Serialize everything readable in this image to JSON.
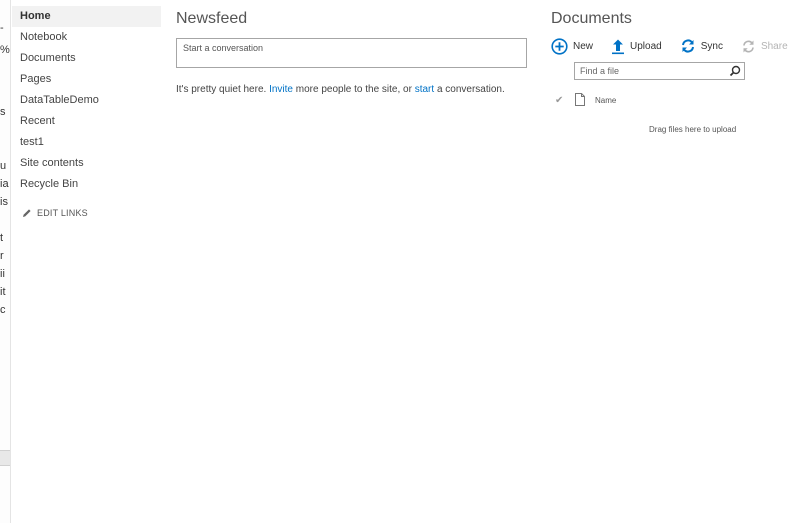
{
  "nav": {
    "items": [
      {
        "label": "Home"
      },
      {
        "label": "Notebook"
      },
      {
        "label": "Documents"
      },
      {
        "label": "Pages"
      },
      {
        "label": "DataTableDemo"
      },
      {
        "label": "Recent"
      },
      {
        "label": "test1"
      },
      {
        "label": "Site contents"
      },
      {
        "label": "Recycle Bin"
      }
    ],
    "selected_index": 0,
    "edit_links_label": "EDIT LINKS"
  },
  "newsfeed": {
    "title": "Newsfeed",
    "conversation_placeholder": "Start a conversation",
    "quiet_text_1": "It's pretty quiet here. ",
    "invite_link": "Invite",
    "quiet_text_2": " more people to the site, or ",
    "start_link": "start",
    "quiet_text_3": " a conversation."
  },
  "documents": {
    "title": "Documents",
    "toolbar": {
      "new_label": "New",
      "upload_label": "Upload",
      "sync_label": "Sync",
      "share_label": "Share"
    },
    "find_placeholder": "Find a file",
    "column_name": "Name",
    "drag_hint": "Drag files here to upload"
  },
  "colors": {
    "accent": "#0072c6",
    "disabled": "#b4b4b4",
    "selected_nav_bg": "#f2f2f2"
  },
  "icons": [
    "pencil-icon",
    "plus-circle-icon",
    "upload-arrow-icon",
    "sync-icon",
    "share-icon",
    "search-icon",
    "checkmark-icon",
    "file-icon"
  ]
}
